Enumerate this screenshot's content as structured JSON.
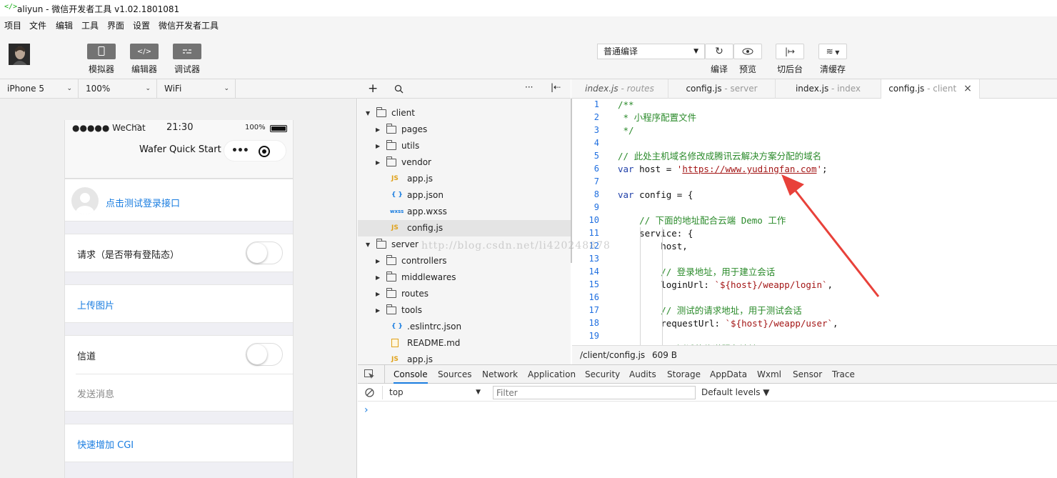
{
  "window": {
    "title": "aliyun - 微信开发者工具 v1.02.1801081"
  },
  "menu": [
    "项目",
    "文件",
    "编辑",
    "工具",
    "界面",
    "设置",
    "微信开发者工具"
  ],
  "toolbar": {
    "left": [
      {
        "label": "模拟器",
        "icon": "phone-icon"
      },
      {
        "label": "编辑器",
        "icon": "code-icon"
      },
      {
        "label": "调试器",
        "icon": "debug-icon"
      }
    ],
    "compile_mode": "普通编译",
    "right": [
      {
        "label": "编译",
        "icon": "refresh-icon"
      },
      {
        "label": "预览",
        "icon": "eye-icon"
      },
      {
        "label": "切后台",
        "icon": "switch-background-icon"
      },
      {
        "label": "清缓存",
        "icon": "layers-icon"
      }
    ]
  },
  "device": {
    "model": "iPhone 5",
    "zoom": "100%",
    "network": "WiFi"
  },
  "phone": {
    "status": {
      "carrier": "●●●●● WeChat",
      "time": "21:30",
      "battery": "100%"
    },
    "nav_title": "Wafer Quick Start",
    "login_link": "点击测试登录接口",
    "request_label": "请求（是否带有登陆态）",
    "upload_link": "上传图片",
    "tunnel_label": "信道",
    "send_message": "发送消息",
    "cgi_link": "快速增加 CGI"
  },
  "filetree": [
    {
      "name": "client",
      "depth": 0,
      "type": "folder",
      "open": true
    },
    {
      "name": "pages",
      "depth": 1,
      "type": "folder",
      "open": false
    },
    {
      "name": "utils",
      "depth": 1,
      "type": "folder",
      "open": false
    },
    {
      "name": "vendor",
      "depth": 1,
      "type": "folder",
      "open": false
    },
    {
      "name": "app.js",
      "depth": 1,
      "type": "js"
    },
    {
      "name": "app.json",
      "depth": 1,
      "type": "json"
    },
    {
      "name": "app.wxss",
      "depth": 1,
      "type": "wxss"
    },
    {
      "name": "config.js",
      "depth": 1,
      "type": "js",
      "selected": true
    },
    {
      "name": "server",
      "depth": 0,
      "type": "folder",
      "open": true
    },
    {
      "name": "controllers",
      "depth": 1,
      "type": "folder",
      "open": false
    },
    {
      "name": "middlewares",
      "depth": 1,
      "type": "folder",
      "open": false
    },
    {
      "name": "routes",
      "depth": 1,
      "type": "folder",
      "open": false
    },
    {
      "name": "tools",
      "depth": 1,
      "type": "folder",
      "open": false
    },
    {
      "name": ".eslintrc.json",
      "depth": 1,
      "type": "json"
    },
    {
      "name": "README.md",
      "depth": 1,
      "type": "md"
    },
    {
      "name": "app.js",
      "depth": 1,
      "type": "js"
    }
  ],
  "icon_labels": {
    "js": "JS",
    "json": "{ }",
    "wxss": "wxss"
  },
  "editor_tabs": [
    {
      "file": "index.js",
      "sep": " - ",
      "dir": "routes",
      "italic": true
    },
    {
      "file": "config.js",
      "sep": " - ",
      "dir": "server"
    },
    {
      "file": "index.js",
      "sep": " - ",
      "dir": "index"
    },
    {
      "file": "config.js",
      "sep": " - ",
      "dir": "client",
      "active": true
    }
  ],
  "code_lines": [
    [
      [
        "c-cm",
        "/**"
      ]
    ],
    [
      [
        "c-cm",
        " * 小程序配置文件"
      ]
    ],
    [
      [
        "c-cm",
        " */"
      ]
    ],
    [],
    [
      [
        "c-cm",
        "// 此处主机域名修改成腾讯云解决方案分配的域名"
      ]
    ],
    [
      [
        "c-kw",
        "var"
      ],
      [
        "c-id",
        " host = "
      ],
      [
        "c-str",
        "'"
      ],
      [
        "c-url",
        "https://www.yudingfan.com"
      ],
      [
        "c-str",
        "'"
      ],
      [
        "c-id",
        ";"
      ]
    ],
    [],
    [
      [
        "c-kw",
        "var"
      ],
      [
        "c-id",
        " config = {"
      ]
    ],
    [],
    [
      [
        "c-cm",
        "    // 下面的地址配合云端 Demo 工作"
      ]
    ],
    [
      [
        "c-id",
        "    service: {"
      ]
    ],
    [
      [
        "c-id",
        "        host,"
      ]
    ],
    [],
    [
      [
        "c-cm",
        "        // 登录地址，用于建立会话"
      ]
    ],
    [
      [
        "c-id",
        "        loginUrl: "
      ],
      [
        "c-str",
        "`${host}/weapp/login`"
      ],
      [
        "c-id",
        ","
      ]
    ],
    [],
    [
      [
        "c-cm",
        "        // 测试的请求地址，用于测试会话"
      ]
    ],
    [
      [
        "c-id",
        "        requestUrl: "
      ],
      [
        "c-str",
        "`${host}/weapp/user`"
      ],
      [
        "c-id",
        ","
      ]
    ],
    [],
    [
      [
        "c-cm",
        "        // 测试的信道服务地址"
      ]
    ]
  ],
  "code_status": {
    "path": "/client/config.js",
    "size": "609 B"
  },
  "console": {
    "tabs": [
      "Console",
      "Sources",
      "Network",
      "Application",
      "Security",
      "Audits",
      "Storage",
      "AppData",
      "Wxml",
      "Sensor",
      "Trace"
    ],
    "active_tab": "Console",
    "context": "top",
    "filter_placeholder": "Filter",
    "levels": "Default levels ▼",
    "prompt": "›"
  },
  "watermark": "http://blog.csdn.net/li420248878",
  "colors": {
    "accent": "#1aad19",
    "link": "#1a7de0",
    "annotation_arrow": "#e8413a"
  }
}
